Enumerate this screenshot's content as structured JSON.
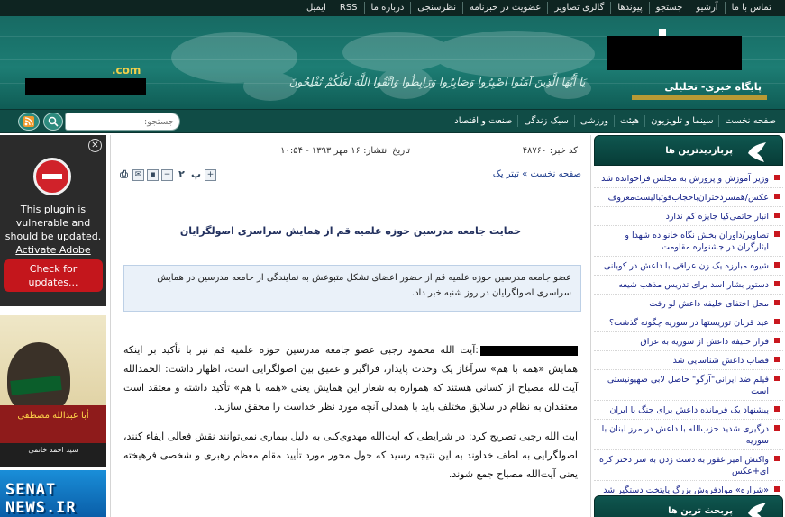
{
  "topnav": {
    "items": [
      "تماس با ما",
      "آرشیو",
      "جستجو",
      "پیوندها",
      "گالری تصاویر",
      "عضویت در خبرنامه",
      "نظرسنجی",
      "درباره ما",
      "RSS",
      "ایمیل"
    ]
  },
  "header": {
    "tagline": "پایگاه خبری- تحلیلی",
    "domain_suffix": ".com",
    "verse": "يَا أَيُّهَا الَّذِينَ آمَنُوا اصْبِرُوا وَصَابِرُوا وَرَابِطُوا وَاتَّقُوا اللَّهَ لَعَلَّكُمْ تُفْلِحُونَ",
    "colors": {
      "banner": "#1d7d74",
      "accent_bar": "#b79a35"
    }
  },
  "menu": {
    "items": [
      "صفحه نخست",
      "سینما و تلویزیون",
      "هیئت",
      "ورزشی",
      "سبک زندگی",
      "صنعت و اقتصاد"
    ],
    "search_placeholder": "جستجو:",
    "search_icon": "magnifier-icon",
    "rss_icon": "rss-icon"
  },
  "flash_notice": {
    "line1": "This plugin is",
    "line2": "vulnerable and",
    "line3": "should be updated.",
    "link": "Activate Adobe Flash.",
    "button": "Check for updates..."
  },
  "ads": {
    "ad1_caption": "أبا عبدالله مصطفى",
    "ad1_line2": "سید احمد خاتمی",
    "ad2_text": "SENAT NEWS.IR"
  },
  "article": {
    "code_label": "کد خبر: ۴۸۷۶۰",
    "date_label": "تاریخ انتشار: ۱۶ مهر ۱۳۹۳ - ۱۰:۵۴",
    "breadcrumb": "صفحه نخست » تیتر یک",
    "title": "حمایت جامعه مدرسین حوزه علمیه قم از همایش سراسری اصولگرایان",
    "lead": "عضو جامعه مدرسین حوزه علمیه قم از حضور اعضای تشکل متبوعش به نمایندگی از جامعه مدرسین در همایش سراسری اصولگرایان در روز شنبه خبر داد.",
    "paragraph1": ":آیت الله محمود رجبی عضو جامعه مدرسین حوزه علمیه قم نیز  با تأکید بر اینکه همایش «همه با هم» سرآغاز یک وحدت پایدار، فراگیر و عمیق بین اصولگرایی است، اظهار داشت: الحمدالله آیت‌الله مصباح از کسانی هستند که همواره به شعار این همایش یعنی «همه با هم»  تأکید داشته و معتقد است معتقدان به نظام در سلایق مختلف باید با همدلی آنچه مورد نظر خداست را محقق سازند.",
    "paragraph2": "آیت الله رجبی تصریح کرد: در شرایطی که آیت‌الله مهدوی‌کنی به دلیل بیماری نمی‌توانند نقش فعالی ایفاء کنند، اصولگرایی به لطف خداوند به این نتیجه رسید که حول محور مورد تأیید مقام معظم رهبری و شخصی فرهیخته یعنی آیت‌الله مصباح جمع شوند.",
    "tools": [
      "print-icon",
      "email-icon",
      "save-icon",
      "font-decrease-icon",
      "font-size-small",
      "font-size-large",
      "font-increase-icon"
    ]
  },
  "sidebar": {
    "most_viewed_title": "پربازدیدترین ها",
    "most_viewed": [
      "وزیر آموزش و پرورش به مجلس فراخوانده شد",
      "عکس/همسردختران‌باحجاب‌فوتبالیست‌معروف",
      "انبار حاتمی‌کیا جایزه کم ندارد",
      "تصاویر/داوران بخش نگاه خانواده شهدا و ایثارگران در جشنواره مقاومت",
      "شیوه مبارزه یک زن عراقی با داعش در کوبانی",
      "دستور بشار اسد برای تدریس مذهب شیعه",
      "محل اختفای خلیفه داعش لو رفت",
      "عید قربان توریستها در سوریه چگونه گذشت؟",
      "فرار خلیفه داعش از سوریه به عراق",
      "قصاب داعش شناسایی شد",
      "فیلم ضد ایرانی\"آرگو\" حاصل لابی صهیونیستی است",
      "پیشنهاد یک فرمانده داعش برای جنگ با ایران",
      "درگیری شدید حزب‌الله با داعش در مرز لبنان با سوریه",
      "واکنش امیر غفور به دست زدن به سر دختر کره ای+عکس",
      "«شراره» موادفروش بزرگ پایتخت دستگیر شد"
    ],
    "most_commented_title": "پربحث ترین ها",
    "colors": {
      "header": "#0f564f",
      "link": "#17238a",
      "bullet": "#c9171e"
    }
  }
}
